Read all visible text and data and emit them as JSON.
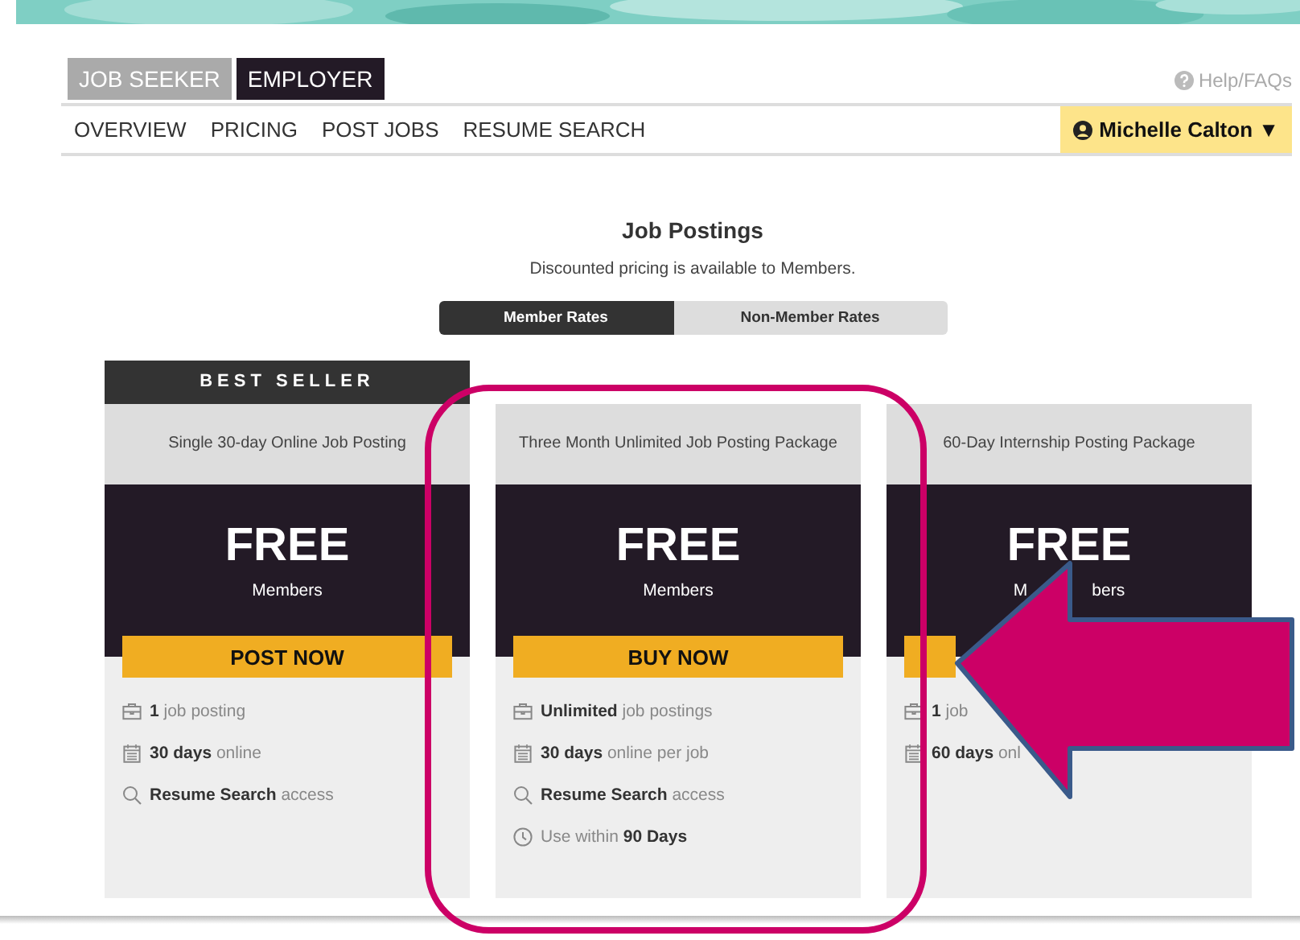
{
  "audience_tabs": [
    {
      "label": "JOB SEEKER",
      "selected": false
    },
    {
      "label": "EMPLOYER",
      "selected": true
    }
  ],
  "help_link": "Help/FAQs",
  "nav": [
    "OVERVIEW",
    "PRICING",
    "POST JOBS",
    "RESUME SEARCH"
  ],
  "user_menu": {
    "name": "Michelle Calton",
    "caret": "▼"
  },
  "heading": "Job Postings",
  "subheading": "Discounted pricing is available to Members.",
  "rate_toggle": [
    {
      "label": "Member Rates",
      "selected": true
    },
    {
      "label": "Non-Member Rates",
      "selected": false
    }
  ],
  "cards": [
    {
      "ribbon": "BEST SELLER",
      "title": "Single 30-day Online Job Posting",
      "price": "FREE",
      "price_note": "Members",
      "button": "POST NOW",
      "features": [
        {
          "kind": "briefcase",
          "text": "**1** job posting"
        },
        {
          "kind": "calendar",
          "text": "**30 days** online"
        },
        {
          "kind": "search",
          "text": "**Resume Search** access"
        }
      ]
    },
    {
      "title": "Three Month Unlimited Job Posting Package",
      "price": "FREE",
      "price_note": "Members",
      "button": "BUY NOW",
      "features": [
        {
          "kind": "briefcase",
          "text": "**Unlimited** job postings"
        },
        {
          "kind": "calendar",
          "text": "**30 days** online per job"
        },
        {
          "kind": "search",
          "text": "**Resume Search** access"
        },
        {
          "kind": "clock",
          "text": "Use within **90 Days**"
        }
      ]
    },
    {
      "title": "60-Day Internship Posting Package",
      "price": "FREE",
      "price_note_parts": [
        "M",
        "bers"
      ],
      "features": [
        {
          "kind": "briefcase",
          "text": "**1** job"
        },
        {
          "kind": "calendar",
          "text": "**60 days** onl"
        }
      ]
    }
  ]
}
